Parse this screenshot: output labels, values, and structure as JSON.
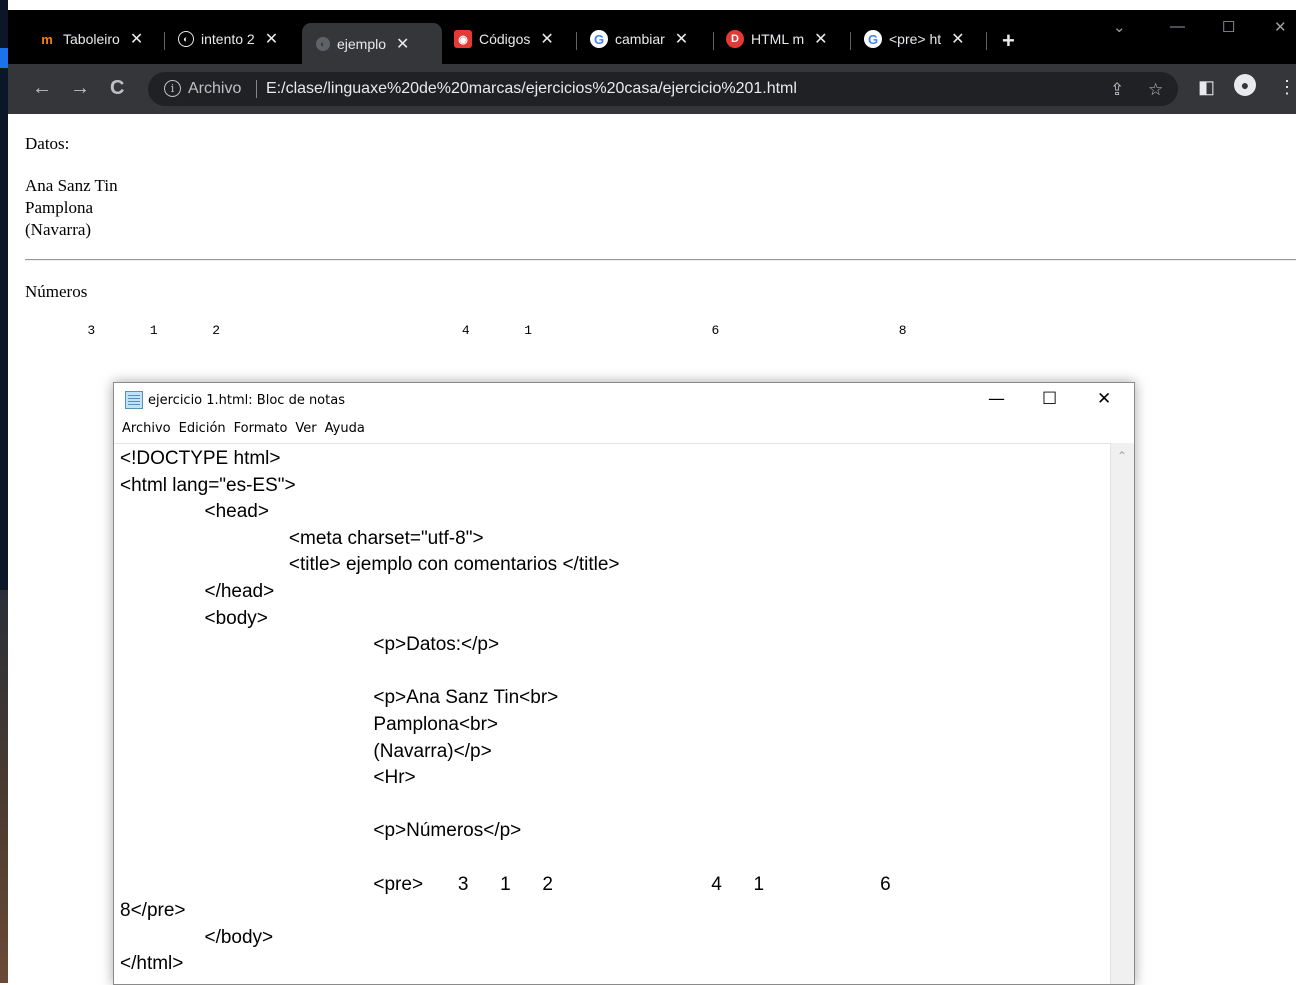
{
  "browser": {
    "tabs": [
      {
        "label": "Taboleiro",
        "icon": "moodle-icon"
      },
      {
        "label": "intento 2",
        "icon": "globe-icon"
      },
      {
        "label": "ejemplo",
        "icon": "globe-icon",
        "active": true
      },
      {
        "label": "Códigos",
        "icon": "red-square-icon"
      },
      {
        "label": "cambiar",
        "icon": "google-icon"
      },
      {
        "label": "HTML m",
        "icon": "red-circle-d-icon"
      },
      {
        "label": "<pre> ht",
        "icon": "google-icon"
      }
    ],
    "new_tab": "+",
    "address": {
      "scheme_label": "Archivo",
      "url": "E:/clase/linguaxe%20de%20marcas/ejercicios%20casa/ejercicio%201.html"
    }
  },
  "page": {
    "datos": "Datos:",
    "address_lines": [
      "Ana Sanz Tin",
      "Pamplona",
      "(Navarra)"
    ],
    "numeros": "Números",
    "pre_text": "\t3\t1\t2\t\t\t\t4\t1\t\t\t6\t\t\t8"
  },
  "notepad": {
    "title": "ejercicio 1.html: Bloc de notas",
    "menu": [
      "Archivo",
      "Edición",
      "Formato",
      "Ver",
      "Ayuda"
    ],
    "code": "<!DOCTYPE html>\n<html lang=\"es-ES\">\n\t\t<head>\n\t\t\t\t<meta charset=\"utf-8\">\n\t\t\t\t<title> ejemplo con comentarios </title>\n\t\t</head>\n\t\t<body>\n\t\t\t\t\t\t<p>Datos:</p>\n\n\t\t\t\t\t\t<p>Ana Sanz Tin<br>\n\t\t\t\t\t\tPamplona<br>\n\t\t\t\t\t\t(Navarra)</p>\n\t\t\t\t\t\t<Hr>\n\n\t\t\t\t\t\t<p>Números</p>\n\n\t\t\t\t\t\t<pre>\t3\t1\t2\t\t\t\t4\t1\t\t\t6\n8</pre>\n\t\t</body>\n</html>"
  }
}
